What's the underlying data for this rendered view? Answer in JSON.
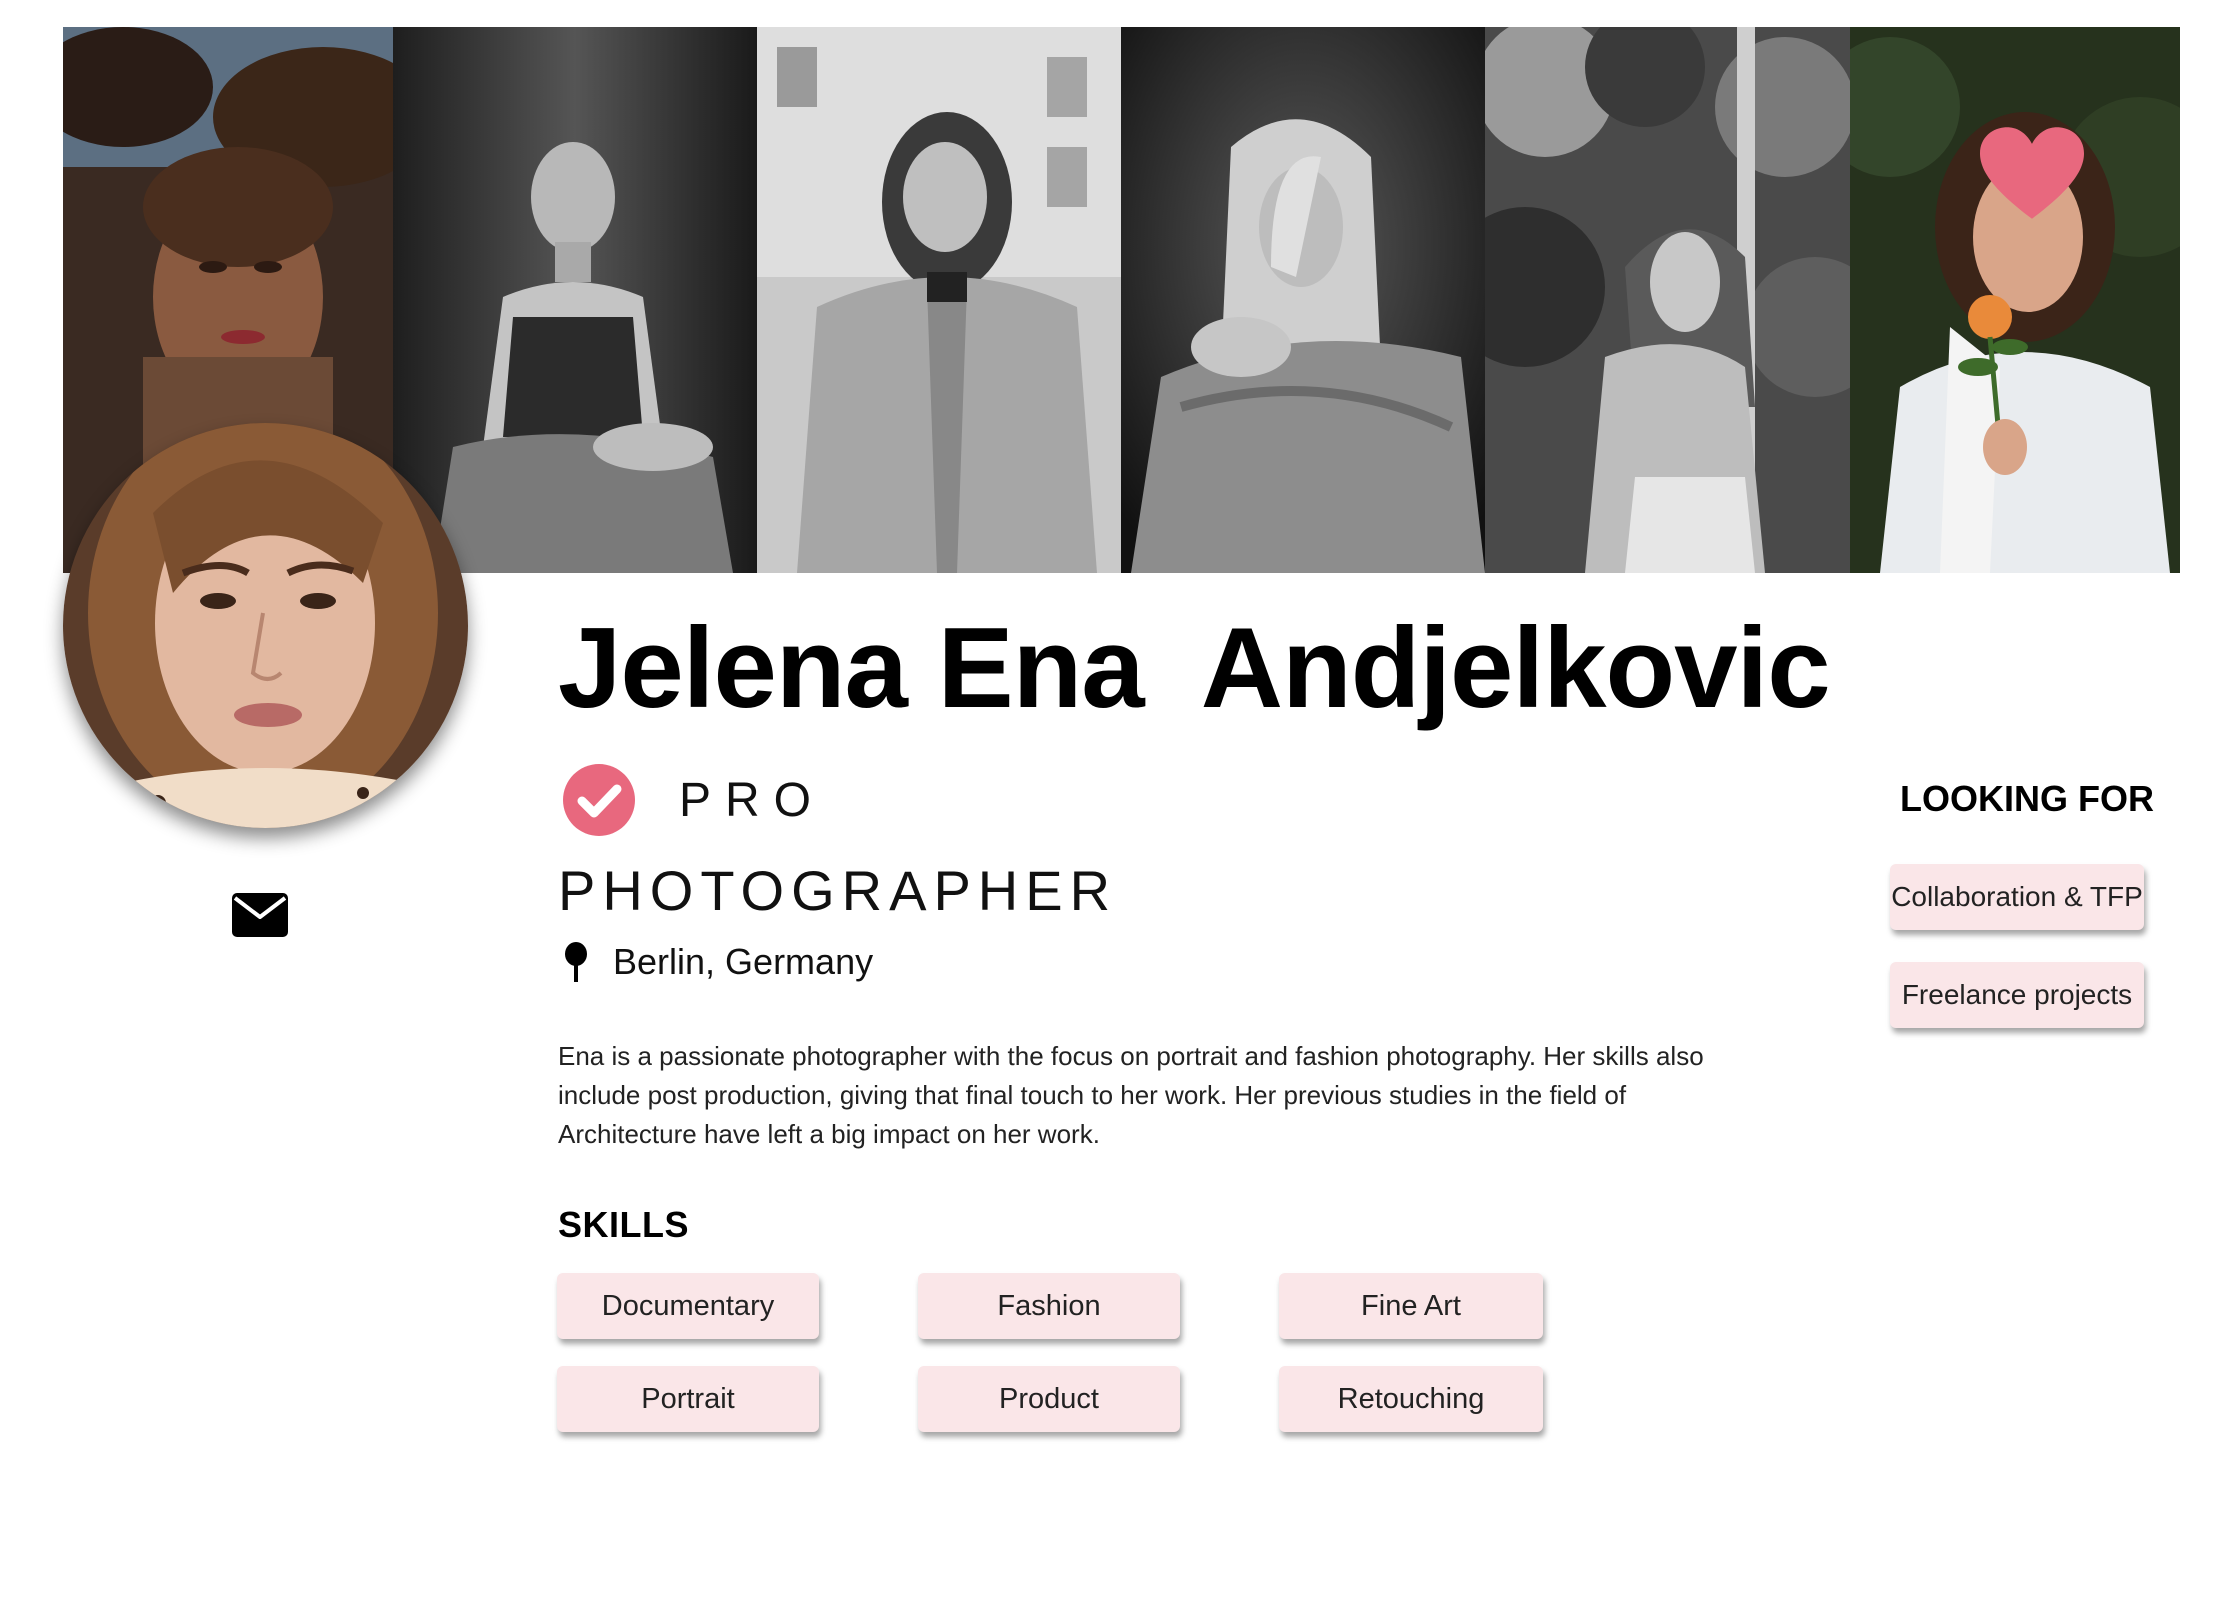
{
  "profile": {
    "name": "Jelena Ena  Andjelkovic",
    "badge": "PRO",
    "role": "PHOTOGRAPHER",
    "location": "Berlin, Germany",
    "bio": "Ena is a passionate photographer with the focus on portrait and fashion photography. Her skills also include post production, giving that final touch to her work. Her previous studies in the field of Architecture have left a big impact on her work."
  },
  "skills": {
    "heading": "SKILLS",
    "items": [
      "Documentary",
      "Fashion",
      "Fine Art",
      "Portrait",
      "Product",
      "Retouching"
    ]
  },
  "looking_for": {
    "heading": "LOOKING FOR",
    "items": [
      "Collaboration & TFP",
      "Freelance projects"
    ]
  },
  "banner": {
    "photos": [
      "portrait-netted-foliage",
      "portrait-seated-bw",
      "portrait-coat-bw",
      "portrait-blanket-bw",
      "portrait-garden-bw",
      "portrait-rose-color"
    ]
  },
  "icons": {
    "mail": "envelope-icon",
    "pro": "check-circle-icon",
    "location": "map-pin-icon",
    "like": "heart-icon"
  },
  "colors": {
    "accent": "#e8687e",
    "chip_bg": "#fae6e8",
    "text": "#000000"
  }
}
